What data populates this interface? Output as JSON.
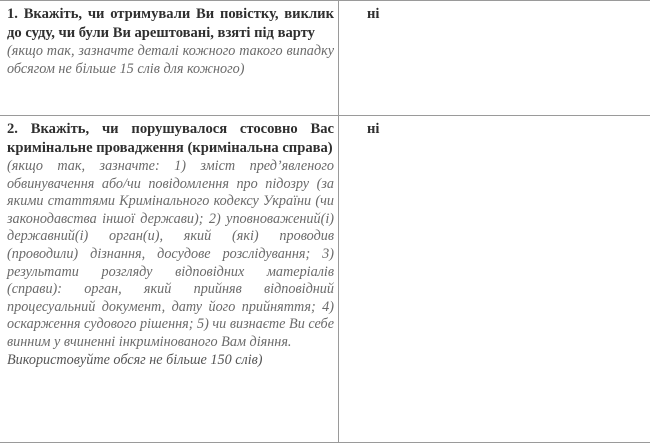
{
  "rows": [
    {
      "question": "1. Вкажіть, чи отримували Ви повістку, виклик до суду, чи були Ви арештовані, взяті під варту",
      "hint": "(якщо так, зазначте деталі кожного такого випадку обсягом не більше 15 слів для кожного)",
      "answer": "ні"
    },
    {
      "question": "2. Вкажіть, чи порушувалося стосовно Вас кримінальне провадження (кримінальна справа)",
      "hint": "(якщо так, зазначте: 1) зміст пред’явленого обвинувачення або/чи повідомлення про підозру (за якими статтями Кримінального кодексу України (чи законодавства іншої держави); 2) уповноважений(і) державний(і) орган(и), який (які) проводив (проводили) дізнання, досудове розслідування; 3) результати розгляду відповідних матеріалів (справи): орган, який прийняв відповідний процесуальний документ, дату його прийняття; 4) оскарження судового рішення; 5) чи визнаєте Ви себе винним у вчиненні інкримінованого Вам діяння.",
      "hint_last": "Використовуйте обсяг не більше 150 слів)",
      "answer": "ні"
    }
  ]
}
